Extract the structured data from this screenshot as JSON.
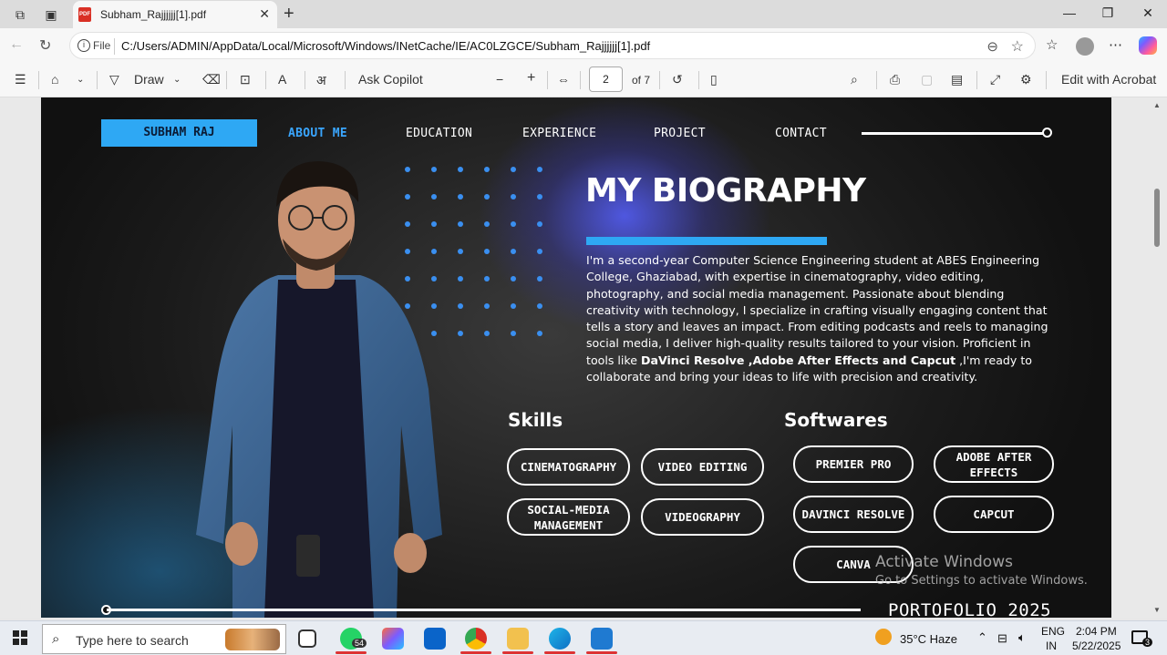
{
  "browser": {
    "tab_title": "Subham_Rajjjjjj[1].pdf",
    "file_label": "File",
    "url": "C:/Users/ADMIN/AppData/Local/Microsoft/Windows/INetCache/IE/AC0LZGCE/Subham_Rajjjjjj[1].pdf"
  },
  "pdf_toolbar": {
    "draw_label": "Draw",
    "ask_copilot_label": "Ask Copilot",
    "page_number": "2",
    "page_total": "of 7",
    "edit_label": "Edit with Acrobat"
  },
  "page": {
    "nav": {
      "name": "SUBHAM RAJ",
      "about": "ABOUT ME",
      "education": "EDUCATION",
      "experience": "EXPERIENCE",
      "project": "PROJECT",
      "contact": "CONTACT"
    },
    "bio_title": "MY BIOGRAPHY",
    "bio_part1": "I'm a second-year Computer Science Engineering student at ABES Engineering College, Ghaziabad, with expertise in cinematography, video editing, photography, and social media management. Passionate about blending creativity with technology, I specialize in crafting visually engaging content that tells a story and leaves an impact. From editing podcasts and reels to managing social media, I deliver high-quality results tailored to your vision. Proficient in tools like ",
    "bio_bold": "DaVinci Resolve ,Adobe After Effects and Capcut",
    "bio_part2": " ,I'm ready to collaborate and bring your ideas to life with precision and creativity.",
    "skills_title": "Skills",
    "skills": [
      "CINEMATOGRAPHY",
      "VIDEO EDITING",
      "SOCIAL-MEDIA MANAGEMENT",
      "VIDEOGRAPHY"
    ],
    "softwares_title": "Softwares",
    "softwares": [
      "PREMIER PRO",
      "ADOBE AFTER EFFECTS",
      "DAVINCI RESOLVE",
      "CAPCUT",
      "CANVA"
    ],
    "footer": "PORTOFOLIO 2025"
  },
  "watermark": {
    "line1": "Activate Windows",
    "line2": "Go to Settings to activate Windows."
  },
  "taskbar": {
    "search_placeholder": "Type here to search",
    "whatsapp_badge": "54",
    "weather": "35°C  Haze",
    "lang1": "ENG",
    "lang2": "IN",
    "time": "2:04 PM",
    "date": "5/22/2025",
    "notif_count": "3"
  },
  "colors": {
    "accent_blue": "#2ea8f4",
    "page_bg": "#1b1b1b"
  }
}
